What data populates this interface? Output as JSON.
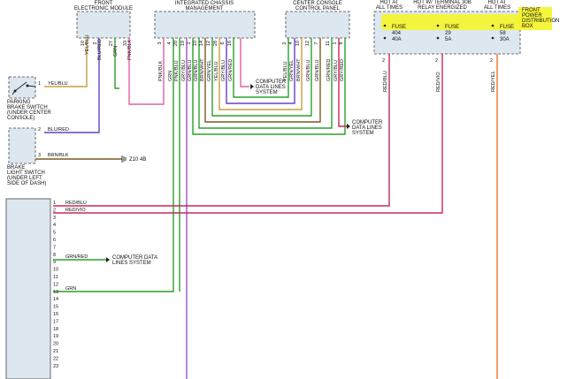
{
  "modules": {
    "fem": {
      "title": "FRONT\nELECTRONIC MODULE"
    },
    "icm": {
      "title": "INTEGRATED CHASSIS\nMANAGEMENT"
    },
    "ccp": {
      "title": "CENTER CONSOLE\nCONTROL PANEL"
    },
    "fpdb": {
      "title": "FRONT\nPOWER\nDISTRIBUTION\nBOX"
    }
  },
  "fuses": [
    {
      "header": "HOT AT\nALL TIMES",
      "label": "FUSE",
      "num": "404",
      "amps": "40A",
      "pin": "2",
      "wire": "RED/BLU"
    },
    {
      "header": "HOT W/ TERMINAL 30B\nRELAY ENERGIZED",
      "label": "FUSE",
      "num": "29",
      "amps": "5A",
      "pin": "2",
      "wire": "RED/VIO"
    },
    {
      "header": "HOT AT\nALL TIMES",
      "label": "FUSE",
      "num": "58",
      "amps": "30A",
      "pin": "2",
      "wire": "RED/YEL"
    }
  ],
  "fem_pins": [
    "10",
    "2",
    "27",
    "33"
  ],
  "fem_wires": [
    "YEL/BLU",
    "BLU/RED",
    "GRN",
    "PNK/BLK"
  ],
  "icm_pins": [
    "3",
    "4",
    "20",
    "19",
    "1",
    "10",
    "14",
    "12",
    "28",
    "6",
    "16"
  ],
  "icm_wires": [
    "PNK/BLK",
    "GRN",
    "PNK/BLU",
    "GRY/BLU",
    "GRN/BLU",
    "GRN/BLU",
    "BRN/WHT",
    "GRN/YEL",
    "YEL/BLU",
    "GRY/BLU",
    "GRN/RED"
  ],
  "ccp_pins": [
    "2",
    "4",
    "10",
    "12",
    "7",
    "11",
    "1",
    "8"
  ],
  "ccp_wires": [
    "YEL/BLU",
    "GRN/YEL",
    "BRN/WHT",
    "GRN/BLU",
    "GRN/BLU",
    "GRN/RED",
    "GRY/BLU",
    "GRY/RED"
  ],
  "components": {
    "parking_brake": {
      "label": "PARKING\nBRAKE SWITCH\n(UNDER CENTER\nCONSOLE)",
      "pin": "1",
      "wire": "YEL/BLU"
    },
    "brake_light": {
      "label": "BRAKE\nLIGHT SWITCH\n(UNDER LEFT\nSIDE OF DASH)",
      "pins": [
        "2",
        "3"
      ],
      "wires": [
        "BLU/RED",
        "BRN/BLK"
      ]
    }
  },
  "ground": "Z10 4B",
  "cdls": [
    "COMPUTER\nDATA LINES\nSYSTEM",
    "COMPUTER\nDATA LINES\nSYSTEM",
    "COMPUTER DATA\nLINES SYSTEM"
  ],
  "connector": {
    "pins": [
      "1",
      "2",
      "3",
      "4",
      "5",
      "6",
      "7",
      "8",
      "9",
      "10",
      "11",
      "12",
      "13",
      "14",
      "15",
      "16",
      "17",
      "18",
      "19",
      "20",
      "21",
      "22",
      "23"
    ],
    "wires": [
      {
        "pin": "1",
        "label": "RED/BLU"
      },
      {
        "pin": "2",
        "label": "RED/VIO"
      },
      {
        "pin": "8",
        "label": "GRN/RED"
      },
      {
        "pin": "12",
        "label": "GRN"
      }
    ]
  },
  "colors": {
    "module_fill": "#dde7f0",
    "highlight": "#f5f52a",
    "yel_blu": "#c8a040",
    "blu_red": "#6a3fc8",
    "grn": "#2aa02a",
    "pnk": "#e060a0",
    "red_blu": "#c8285a",
    "red_yel": "#f07030",
    "vio": "#a070d8",
    "brn": "#7a5a20"
  }
}
